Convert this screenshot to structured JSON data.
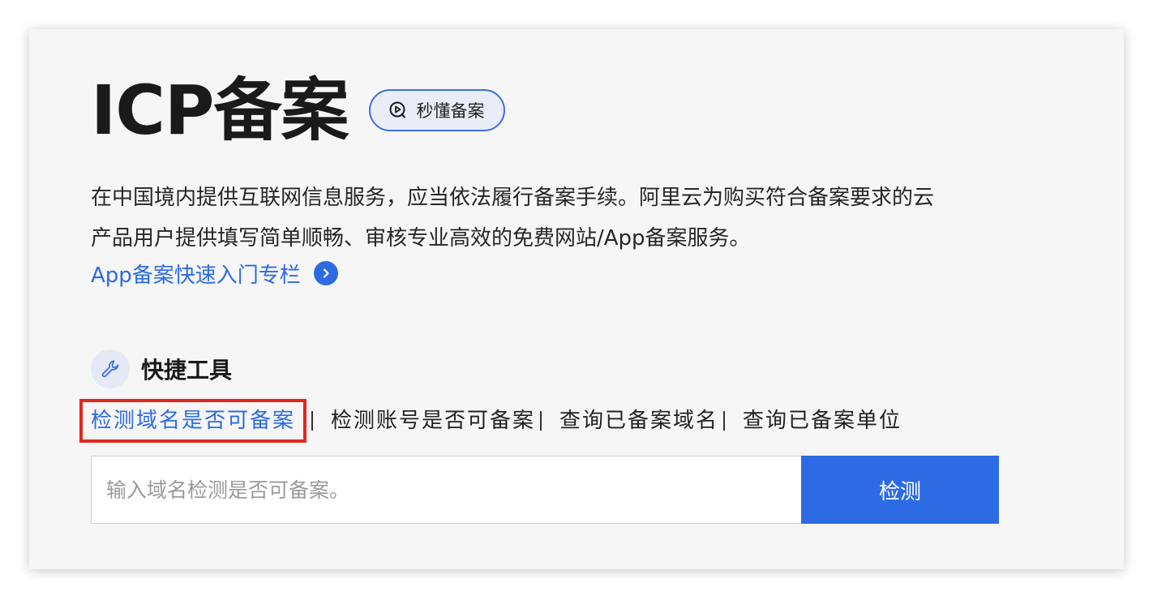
{
  "header": {
    "title": "ICP备案",
    "video_button_label": "秒懂备案",
    "video_button_icon": "play-circle-icon"
  },
  "intro": {
    "line1": "在中国境内提供互联网信息服务，应当依法履行备案手续。阿里云为购买符合备案要求的云",
    "line2": "产品用户提供填写简单顺畅、审核专业高效的免费网站/App备案服务。",
    "guide_link": "App备案快速入门专栏",
    "guide_link_icon": "chevron-right-icon"
  },
  "tools": {
    "title": "快捷工具",
    "icon": "wrench-icon",
    "tabs": [
      {
        "label": "检测域名是否可备案",
        "active": true
      },
      {
        "label": "检测账号是否可备案",
        "active": false
      },
      {
        "label": "查询已备案域名",
        "active": false
      },
      {
        "label": "查询已备案单位",
        "active": false
      }
    ],
    "search": {
      "placeholder": "输入域名检测是否可备案。",
      "value": "",
      "button_label": "检测"
    }
  },
  "colors": {
    "accent": "#2d6be4",
    "highlight_border": "#e0281e",
    "panel_bg": "#f6f6f6"
  }
}
